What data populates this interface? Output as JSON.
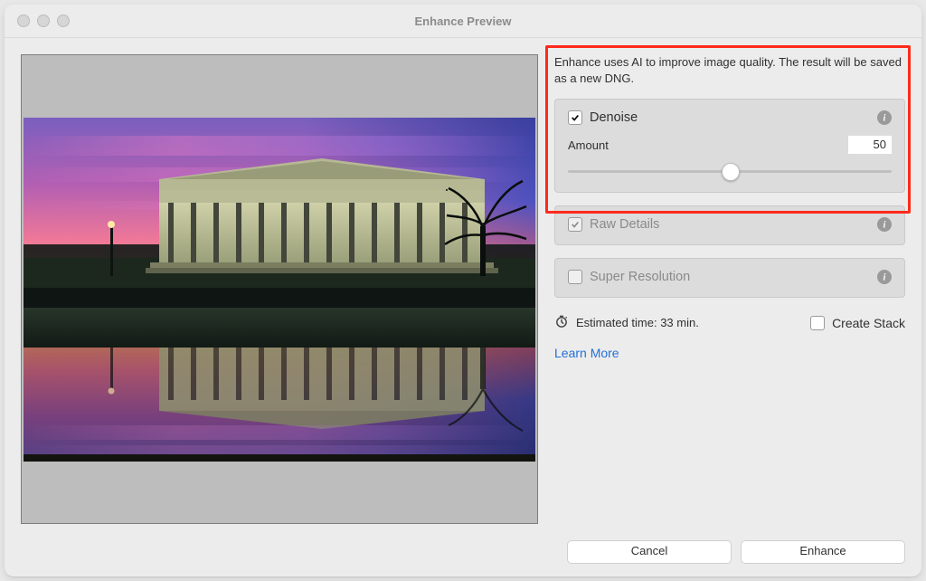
{
  "window": {
    "title": "Enhance Preview"
  },
  "description": "Enhance uses AI to improve image quality. The result will be saved as a new DNG.",
  "denoise": {
    "label": "Denoise",
    "checked": true,
    "amount_label": "Amount",
    "amount_value": "50"
  },
  "raw_details": {
    "label": "Raw Details",
    "checked": true,
    "enabled": false
  },
  "super_res": {
    "label": "Super Resolution",
    "checked": false,
    "enabled": false
  },
  "estimate": {
    "label": "Estimated time: 33 min."
  },
  "stack": {
    "label": "Create Stack",
    "checked": false
  },
  "learn_more": "Learn More",
  "buttons": {
    "cancel": "Cancel",
    "enhance": "Enhance"
  },
  "icons": {
    "info": "info-icon",
    "timer": "timer-icon"
  }
}
